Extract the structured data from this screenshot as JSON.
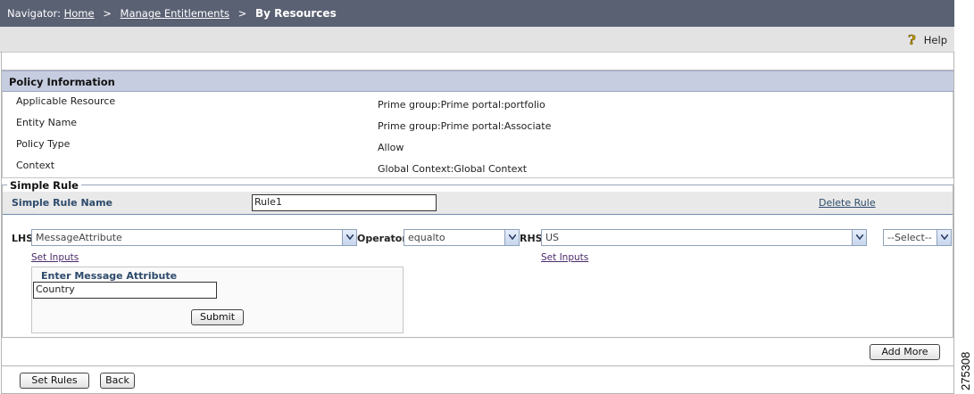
{
  "navigator": {
    "prefix": "Navigator:",
    "home": "Home",
    "manage": "Manage Entitlements",
    "sep1": ">",
    "sep2": ">",
    "current": "By Resources"
  },
  "help": {
    "label": "Help",
    "icon": "help-icon"
  },
  "policy": {
    "header": "Policy Information",
    "rows": [
      {
        "label": "Applicable Resource",
        "value": "Prime group:Prime portal:portfolio"
      },
      {
        "label": "Entity Name",
        "value": "Prime group:Prime portal:Associate"
      },
      {
        "label": "Policy Type",
        "value": "Allow"
      },
      {
        "label": "Context",
        "value": "Global Context:Global Context"
      }
    ]
  },
  "rule": {
    "section_title": "Simple Rule",
    "name_label": "Simple Rule Name",
    "name_value": "Rule1",
    "delete_label": "Delete Rule",
    "lhs_label": "LHS",
    "lhs_value": "MessageAttribute",
    "operator_label": "Operator",
    "operator_value": "equalto",
    "rhs_label": "RHS",
    "rhs_value": "US",
    "connector_value": "--Select--",
    "set_inputs_left": "Set Inputs",
    "set_inputs_right": "Set Inputs",
    "message_box": {
      "title": "Enter Message Attribute",
      "value": "Country",
      "submit_label": "Submit"
    },
    "add_more_label": "Add More"
  },
  "footer": {
    "set_rules_label": "Set Rules",
    "back_label": "Back"
  },
  "figure_id": "275308"
}
